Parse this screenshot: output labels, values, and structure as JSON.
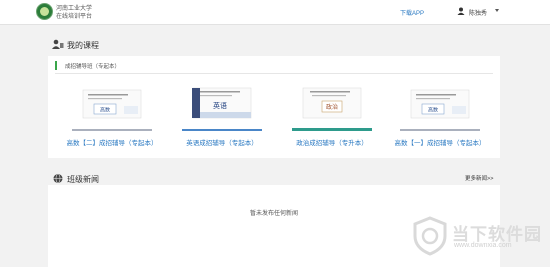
{
  "header": {
    "brand_line1": "河南工业大学",
    "brand_line2": "在线培训平台",
    "download_label": "下载APP",
    "username": "陈独秀",
    "icons": [
      "logo",
      "user-icon",
      "chevron-down-icon"
    ]
  },
  "courses_section": {
    "title": "我的课程",
    "icon": "user-books-icon",
    "subheading": "成招辅导班（专起本）",
    "items": [
      {
        "label": "高数【二】成招辅导（专起本）",
        "cover_title": "高数",
        "bar_color": "#aab0bd"
      },
      {
        "label": "英语成招辅导（专起本）",
        "cover_title": "英语",
        "bar_color": "#4a86c8"
      },
      {
        "label": "政治成招辅导（专升本）",
        "cover_title": "政治",
        "bar_color": "#2e9b8c"
      },
      {
        "label": "高数【一】成招辅导（专起本）",
        "cover_title": "高数",
        "bar_color": "#aab0bd"
      }
    ]
  },
  "news_section": {
    "title": "班级新闻",
    "icon": "news-globe-icon",
    "more_label": "更多新闻>>",
    "empty_text": "暂未发布任何新闻"
  },
  "watermark": {
    "text": "当下软件园",
    "url": "www.downxia.com"
  },
  "colors": {
    "accent_green": "#3aa64a",
    "link_blue": "#2a79c2"
  }
}
